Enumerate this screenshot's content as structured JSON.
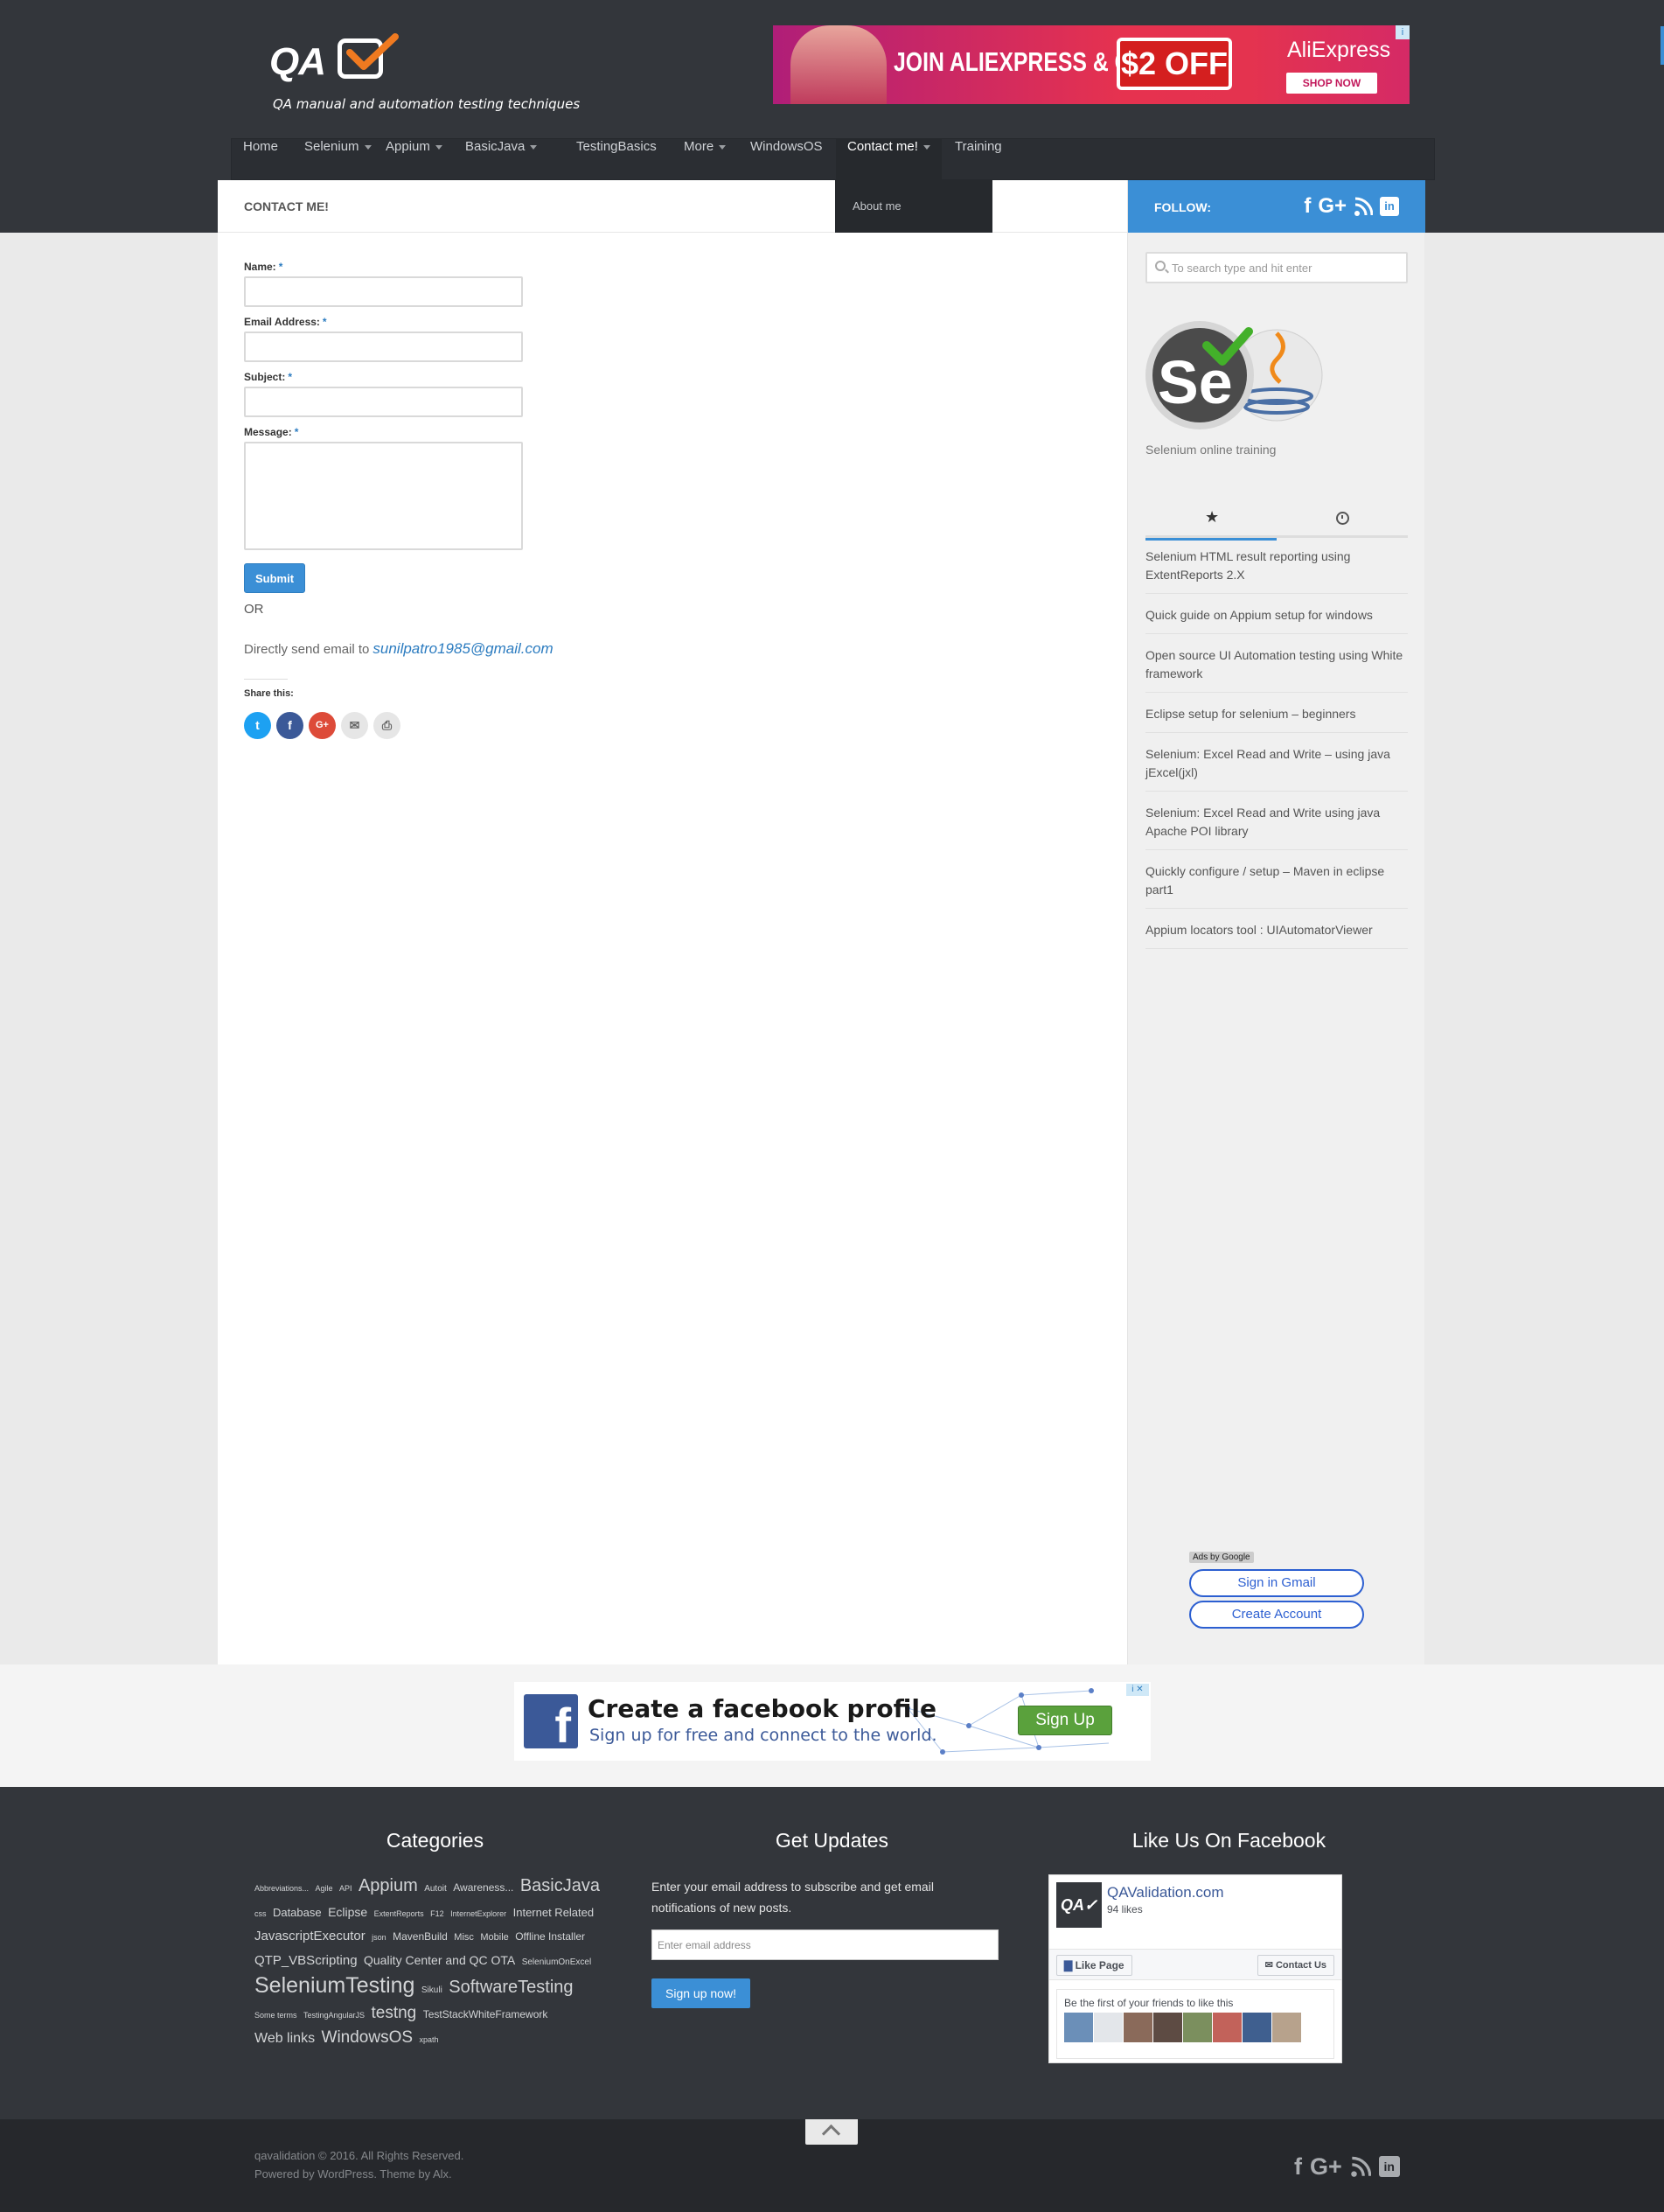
{
  "site": {
    "logo_text": "QA",
    "tagline": "QA manual and automation testing techniques"
  },
  "top_ad": {
    "headline": "JOIN ALIEXPRESS & GET",
    "offer": "$2 OFF",
    "brand": "AliExpress",
    "cta": "SHOP NOW",
    "choice": "i"
  },
  "nav": {
    "items": [
      {
        "label": "Home",
        "has_caret": false
      },
      {
        "label": "Selenium",
        "has_caret": true
      },
      {
        "label": "Appium",
        "has_caret": true
      },
      {
        "label": "BasicJava",
        "has_caret": true
      },
      {
        "label": "TestingBasics",
        "has_caret": false
      },
      {
        "label": "More",
        "has_caret": true
      },
      {
        "label": "WindowsOS",
        "has_caret": false
      },
      {
        "label": "Contact me!",
        "has_caret": true,
        "active": true
      },
      {
        "label": "Training",
        "has_caret": false
      }
    ],
    "dropdown": [
      "About me"
    ]
  },
  "page": {
    "title": "Contact me!",
    "form": {
      "name_label": "Name:",
      "email_label": "Email Address:",
      "subject_label": "Subject:",
      "message_label": "Message:",
      "required_mark": "*",
      "submit": "Submit"
    },
    "or": "OR",
    "direct_text": "Directly send email to",
    "email": "sunilpatro1985@gmail.com",
    "share_label": "Share this:",
    "share_buttons": [
      {
        "name": "twitter",
        "glyph": "t",
        "color": "#1da1f2"
      },
      {
        "name": "facebook",
        "glyph": "f",
        "color": "#3b5998"
      },
      {
        "name": "google-plus",
        "glyph": "G+",
        "color": "#dd4b39"
      },
      {
        "name": "email",
        "glyph": "✉",
        "color": "#e6e6e6"
      },
      {
        "name": "print",
        "glyph": "⎙",
        "color": "#e6e6e6"
      }
    ]
  },
  "sidebar": {
    "follow_label": "Follow:",
    "follow_icons": [
      "f",
      "G+",
      "rss",
      "in"
    ],
    "search_placeholder": "To search type and hit enter",
    "image_caption": "Selenium online training",
    "tabs": [
      "star-icon",
      "clock-icon"
    ],
    "posts": [
      "Selenium HTML result reporting using ExtentReports 2.X",
      "Quick guide on Appium setup for windows",
      "Open source UI Automation testing using White framework",
      "Eclipse setup for selenium – beginners",
      "Selenium: Excel Read and Write – using java jExcel(jxl)",
      "Selenium: Excel Read and Write using java Apache POI library",
      "Quickly configure / setup – Maven in eclipse part1",
      "Appium locators tool : UIAutomatorViewer"
    ],
    "ads_by": "Ads by Google",
    "sign_in": "Sign in Gmail",
    "create_account": "Create Account"
  },
  "fb_ad": {
    "title": "Create a facebook profile",
    "subtitle": "Sign up for free and connect to the world.",
    "cta": "Sign Up",
    "close": "i ✕"
  },
  "footer": {
    "categories_heading": "Categories",
    "updates_heading": "Get Updates",
    "facebook_heading": "Like Us On Facebook",
    "tags": [
      {
        "t": "Abbreviations...",
        "s": 9
      },
      {
        "t": "Agile",
        "s": 9
      },
      {
        "t": "API",
        "s": 9
      },
      {
        "t": "Appium",
        "s": 20
      },
      {
        "t": "Autoit",
        "s": 10
      },
      {
        "t": "Awareness...",
        "s": 12
      },
      {
        "t": "BasicJava",
        "s": 20
      },
      {
        "t": "css",
        "s": 9
      },
      {
        "t": "Database",
        "s": 13
      },
      {
        "t": "Eclipse",
        "s": 14
      },
      {
        "t": "ExtentReports",
        "s": 9
      },
      {
        "t": "F12",
        "s": 9
      },
      {
        "t": "InternetExplorer",
        "s": 9
      },
      {
        "t": "Internet Related",
        "s": 13
      },
      {
        "t": "JavascriptExecutor",
        "s": 15
      },
      {
        "t": "json",
        "s": 9
      },
      {
        "t": "MavenBuild",
        "s": 12
      },
      {
        "t": "Misc",
        "s": 11
      },
      {
        "t": "Mobile",
        "s": 11
      },
      {
        "t": "Offline Installer",
        "s": 12
      },
      {
        "t": "QTP_VBScripting",
        "s": 15
      },
      {
        "t": "Quality Center and QC OTA",
        "s": 14
      },
      {
        "t": "SeleniumOnExcel",
        "s": 10
      },
      {
        "t": "SeleniumTesting",
        "s": 25
      },
      {
        "t": "Sikuli",
        "s": 10
      },
      {
        "t": "SoftwareTesting",
        "s": 20
      },
      {
        "t": "Some terms",
        "s": 9
      },
      {
        "t": "TestingAngularJS",
        "s": 9
      },
      {
        "t": "testng",
        "s": 19
      },
      {
        "t": "TestStackWhiteFramework",
        "s": 12
      },
      {
        "t": "Web links",
        "s": 16
      },
      {
        "t": "WindowsOS",
        "s": 19
      },
      {
        "t": "xpath",
        "s": 9
      }
    ],
    "updates_text": "Enter your email address to subscribe and get email notifications of new posts.",
    "updates_placeholder": "Enter email address",
    "updates_button": "Sign up now!",
    "fb_page_name": "QAValidation.com",
    "fb_likes": "94 likes",
    "fb_like_button": "Like Page",
    "fb_contact_button": "Contact Us",
    "fb_first": "Be the first of your friends to like this",
    "copyright_line1": "qavalidation © 2016. All Rights Reserved.",
    "copyright_line2": "Powered by WordPress. Theme by Alx."
  }
}
